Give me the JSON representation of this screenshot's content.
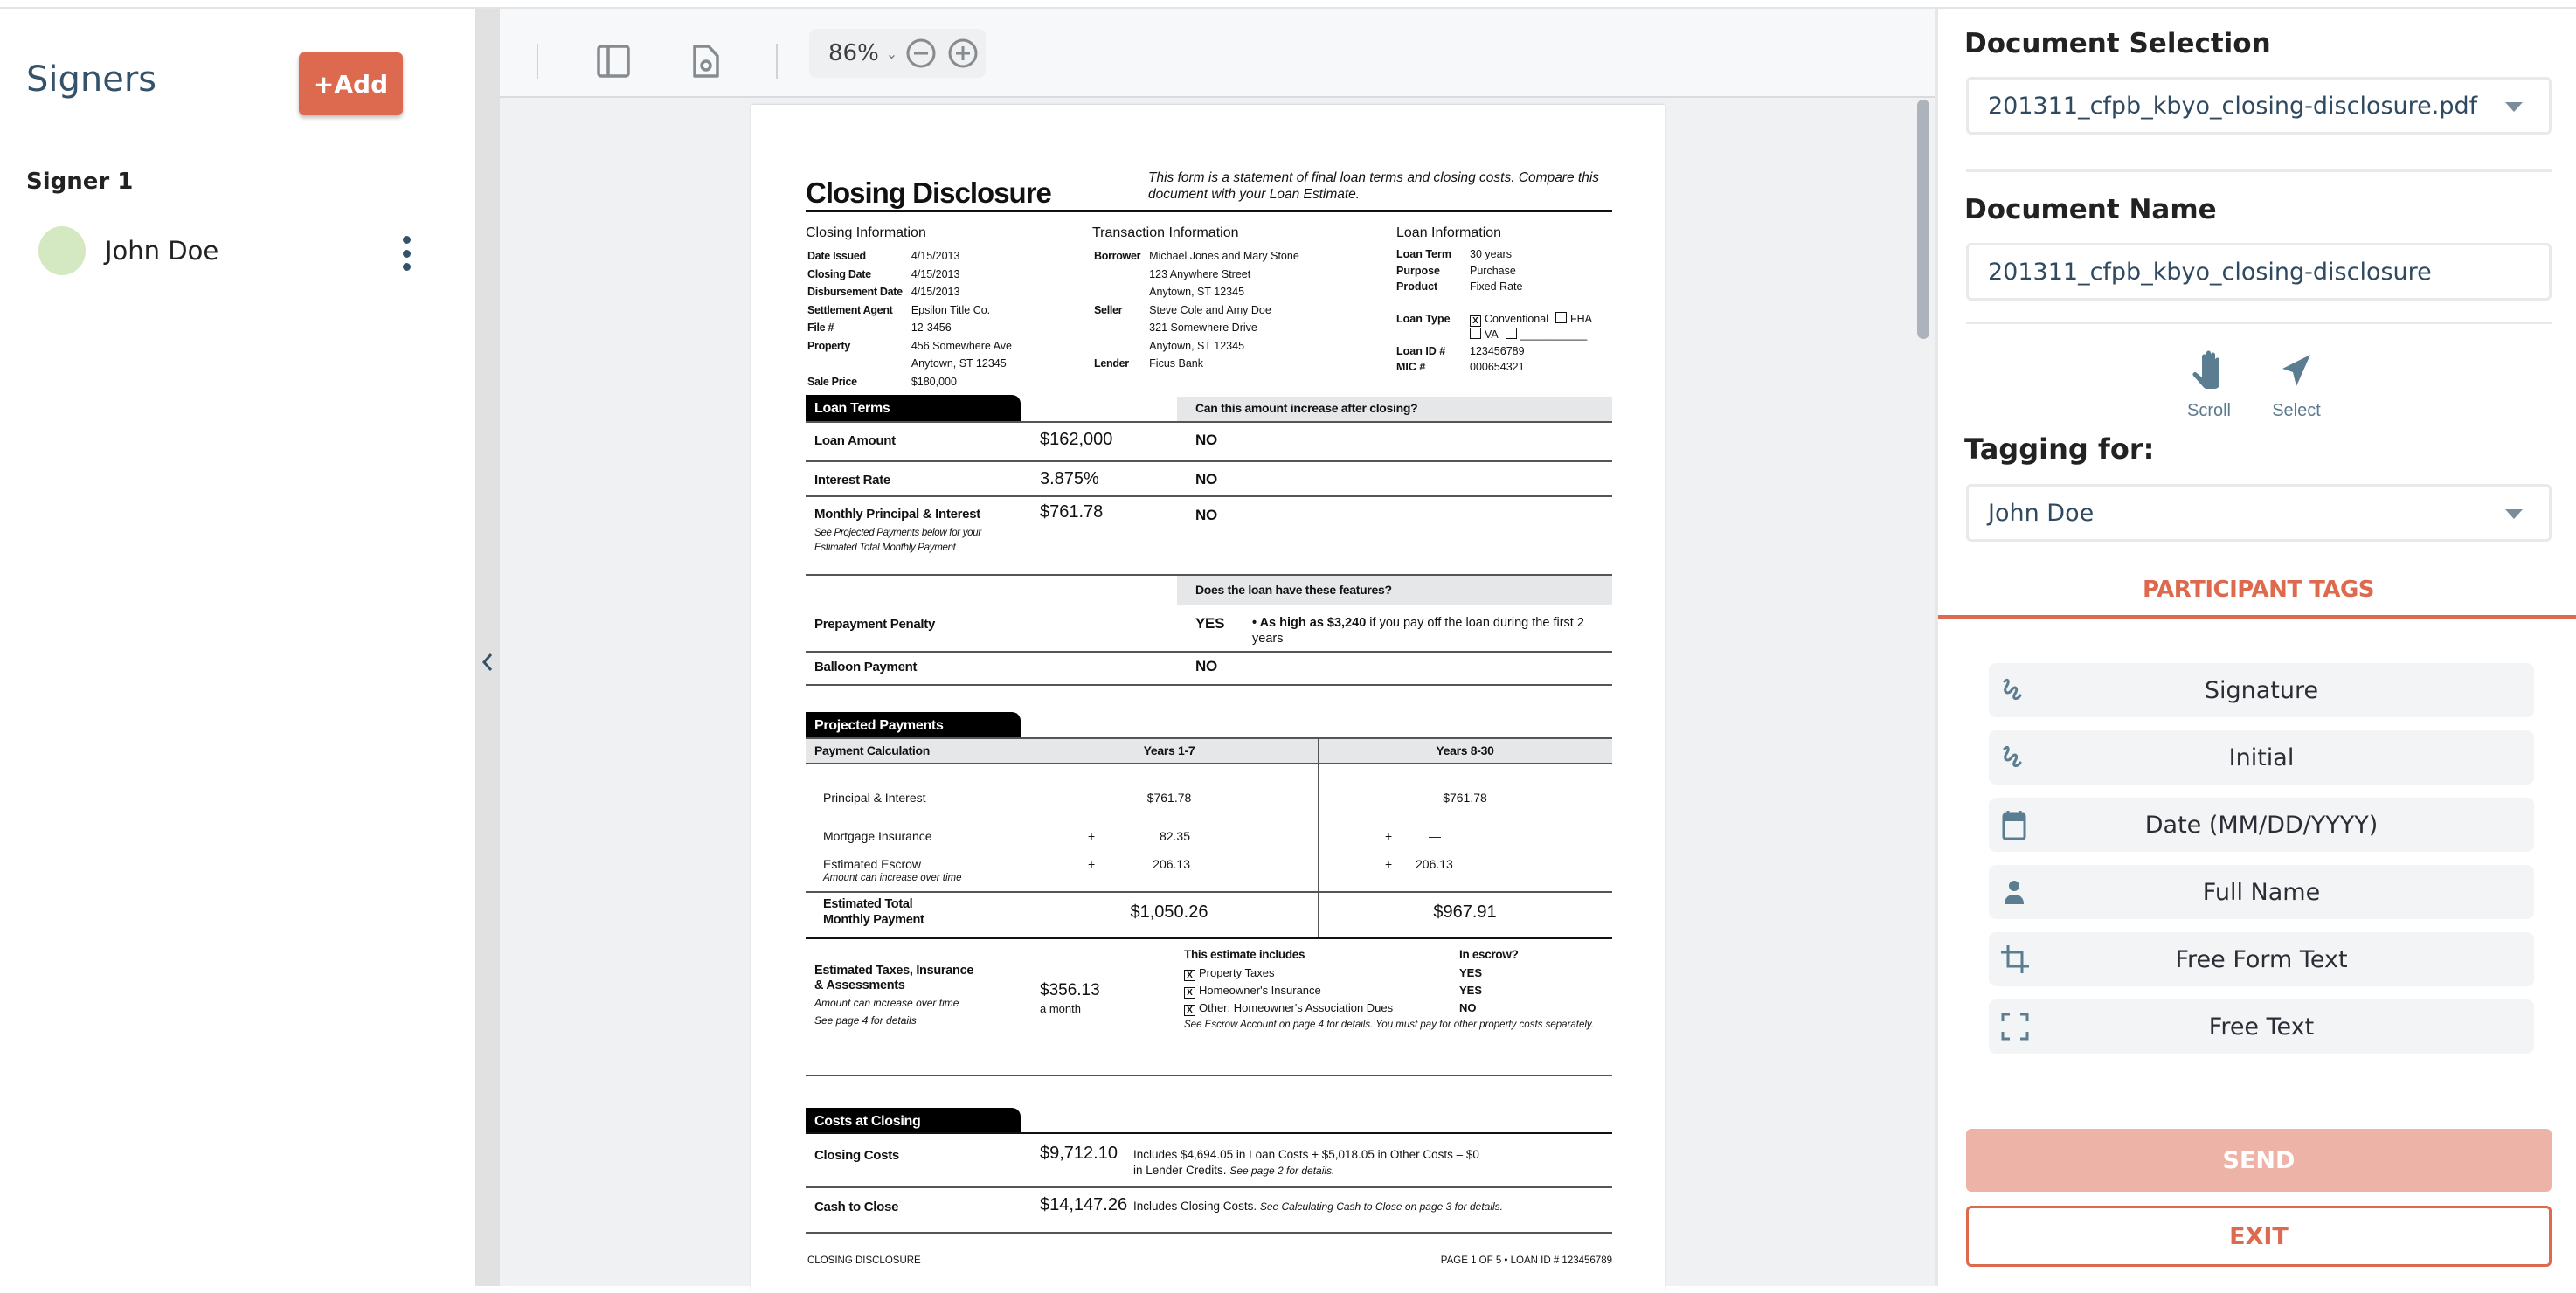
{
  "sidebar": {
    "title": "Signers",
    "add_label": "+Add",
    "signer_label": "Signer 1",
    "signer_name": "John Doe",
    "avatar_color": "#d4e9c2"
  },
  "toolbar": {
    "zoom_value": "86%"
  },
  "document": {
    "title": "Closing Disclosure",
    "intro": "This form is a statement of final loan terms and closing costs. Compare this document with your Loan Estimate.",
    "closing_info": {
      "heading": "Closing  Information",
      "rows": [
        {
          "k": "Date Issued",
          "v": "4/15/2013"
        },
        {
          "k": "Closing Date",
          "v": "4/15/2013"
        },
        {
          "k": "Disbursement Date",
          "v": "4/15/2013"
        },
        {
          "k": "Settlement Agent",
          "v": "Epsilon Title Co."
        },
        {
          "k": "File #",
          "v": "12-3456"
        },
        {
          "k": "Property",
          "v": "456 Somewhere Ave"
        },
        {
          "k": "",
          "v": "Anytown, ST 12345"
        },
        {
          "k": "Sale Price",
          "v": "$180,000"
        }
      ]
    },
    "transaction_info": {
      "heading": "Transaction  Information",
      "rows": [
        {
          "k": "Borrower",
          "v": "Michael Jones and Mary Stone"
        },
        {
          "k": "",
          "v": "123 Anywhere Street"
        },
        {
          "k": "",
          "v": "Anytown, ST 12345"
        },
        {
          "k": "Seller",
          "v": "Steve Cole and Amy Doe"
        },
        {
          "k": "",
          "v": "321 Somewhere Drive"
        },
        {
          "k": "",
          "v": "Anytown, ST 12345"
        },
        {
          "k": "Lender",
          "v": "Ficus Bank"
        }
      ]
    },
    "loan_info": {
      "heading": "Loan  Information",
      "loan_term_k": "Loan Term",
      "loan_term": "30 years",
      "purpose_k": "Purpose",
      "purpose": "Purchase",
      "product_k": "Product",
      "product": "Fixed Rate",
      "loan_type_k": "Loan Type",
      "loan_type_options": [
        "Conventional",
        "FHA",
        "VA",
        "___________"
      ],
      "loan_type_checked": "Conventional",
      "loan_id_k": "Loan ID #",
      "loan_id": "123456789",
      "mic_k": "MIC #",
      "mic": "000654321"
    },
    "loan_terms": {
      "tab": "Loan Terms",
      "question1": "Can this amount increase after closing?",
      "question2": "Does the loan have these features?",
      "rows": [
        {
          "label": "Loan Amount",
          "value": "$162,000",
          "answer": "NO"
        },
        {
          "label": "Interest Rate",
          "value": "3.875%",
          "answer": "NO"
        },
        {
          "label": "Monthly Principal & Interest",
          "note": "See Projected Payments below for your Estimated Total Monthly Payment",
          "value": "$761.78",
          "answer": "NO"
        },
        {
          "label": "Prepayment Penalty",
          "value": "",
          "answer": "YES",
          "detail_bold": "• As high as $3,240",
          "detail": " if you pay off the loan during the first 2 years"
        },
        {
          "label": "Balloon Payment",
          "value": "",
          "answer": "NO"
        }
      ]
    },
    "projected": {
      "tab": "Projected Payments",
      "col0": "Payment Calculation",
      "col1": "Years 1-7",
      "col2": "Years 8-30",
      "pi_label": "Principal & Interest",
      "pi_1": "$761.78",
      "pi_2": "$761.78",
      "mi_label": "Mortgage Insurance",
      "mi_1": "82.35",
      "mi_2": "—",
      "esc_label": "Estimated Escrow",
      "esc_note": "Amount can increase over time",
      "esc_1": "206.13",
      "esc_2": "206.13",
      "plus": "+",
      "total_label_1": "Estimated Total",
      "total_label_2": "Monthly Payment",
      "total_1": "$1,050.26",
      "total_2": "$967.91",
      "tia_label_1": "Estimated Taxes, Insurance",
      "tia_label_2": "& Assessments",
      "tia_note_1": "Amount can increase over time",
      "tia_note_2": "See page 4 for details",
      "tia_value": "$356.13",
      "tia_period": "a month",
      "includes_h": "This estimate includes",
      "escrow_h": "In escrow?",
      "includes": [
        {
          "item": "Property Taxes",
          "escrow": "YES"
        },
        {
          "item": "Homeowner's Insurance",
          "escrow": "YES"
        },
        {
          "item": "Other: Homeowner's Association Dues",
          "escrow": "NO"
        }
      ],
      "includes_note": "See Escrow Account on page 4 for details. You must pay for other property costs separately."
    },
    "costs": {
      "tab": "Costs at Closing",
      "cc_label": "Closing Costs",
      "cc_value": "$9,712.10",
      "cc_desc_1": "Includes $4,694.05 in Loan Costs + $5,018.05 in Other Costs – $0",
      "cc_desc_2": "in Lender Credits. ",
      "cc_desc_2i": "See page 2 for details.",
      "ctc_label": "Cash to Close",
      "ctc_value": "$14,147.26",
      "ctc_desc": "Includes Closing Costs. ",
      "ctc_desc_i": "See Calculating Cash to Close on page 3 for details."
    },
    "footer_left": "CLOSING DISCLOSURE",
    "footer_right": "PAGE 1 OF 5 • LOAN ID # 123456789"
  },
  "right_panel": {
    "doc_selection_label": "Document Selection",
    "doc_selection_value": "201311_cfpb_kbyo_closing-disclosure.pdf",
    "doc_name_label": "Document Name",
    "doc_name_value": "201311_cfpb_kbyo_closing-disclosure",
    "mode_scroll": "Scroll",
    "mode_select": "Select",
    "tagging_label": "Tagging for:",
    "tagging_value": "John Doe",
    "tab_label": "PARTICIPANT TAGS",
    "tags": [
      {
        "label": "Signature",
        "icon": "signature-icon"
      },
      {
        "label": "Initial",
        "icon": "initial-icon"
      },
      {
        "label": "Date (MM/DD/YYYY)",
        "icon": "calendar-icon"
      },
      {
        "label": "Full Name",
        "icon": "person-icon"
      },
      {
        "label": "Free Form Text",
        "icon": "crop-icon"
      },
      {
        "label": "Free Text",
        "icon": "frame-icon"
      }
    ],
    "send_label": "SEND",
    "exit_label": "EXIT",
    "accent_color": "#dd694e"
  }
}
